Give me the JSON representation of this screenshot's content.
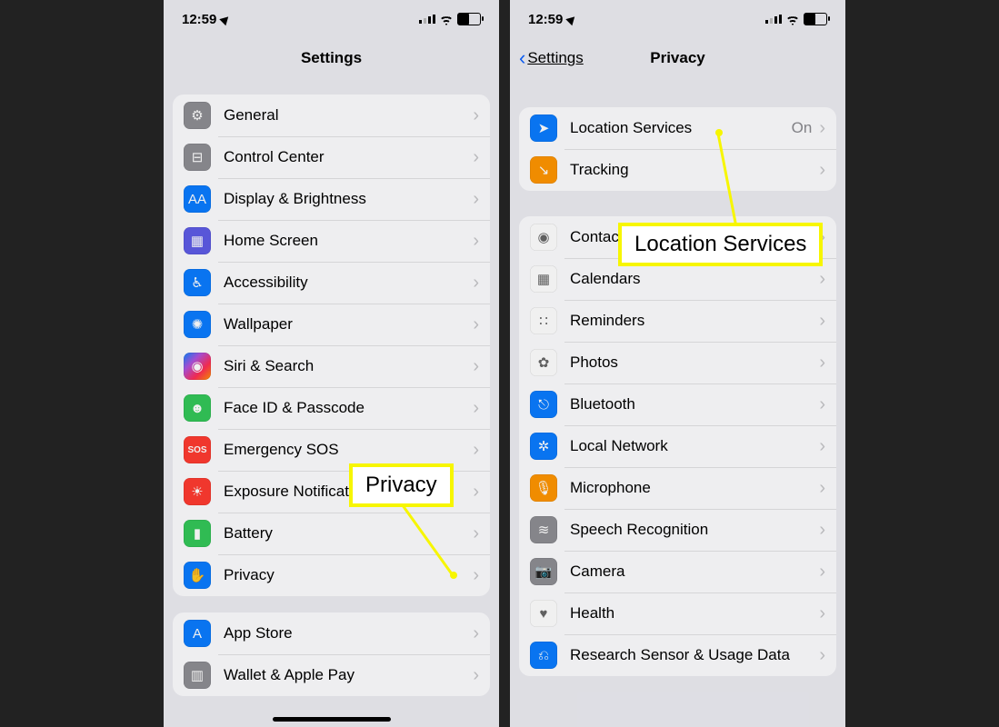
{
  "status": {
    "time": "12:59"
  },
  "left": {
    "title": "Settings",
    "group1": [
      {
        "label": "General",
        "icon": "⚙︎",
        "bg": "bg-gray"
      },
      {
        "label": "Control Center",
        "icon": "⊟",
        "bg": "bg-gray"
      },
      {
        "label": "Display & Brightness",
        "icon": "AA",
        "bg": "bg-blue"
      },
      {
        "label": "Home Screen",
        "icon": "▦",
        "bg": "bg-purple"
      },
      {
        "label": "Accessibility",
        "icon": "♿︎",
        "bg": "bg-blue"
      },
      {
        "label": "Wallpaper",
        "icon": "✺",
        "bg": "bg-blue"
      },
      {
        "label": "Siri & Search",
        "icon": "◉",
        "bg": "bg-siri"
      },
      {
        "label": "Face ID & Passcode",
        "icon": "☻",
        "bg": "bg-green"
      },
      {
        "label": "Emergency SOS",
        "icon": "SOS",
        "bg": "bg-red"
      },
      {
        "label": "Exposure Notifications",
        "icon": "☀︎",
        "bg": "bg-cor"
      },
      {
        "label": "Battery",
        "icon": "▮",
        "bg": "bg-green"
      },
      {
        "label": "Privacy",
        "icon": "✋",
        "bg": "bg-blue"
      }
    ],
    "group2": [
      {
        "label": "App Store",
        "icon": "A",
        "bg": "bg-blue"
      },
      {
        "label": "Wallet & Apple Pay",
        "icon": "▥",
        "bg": "bg-gray"
      }
    ]
  },
  "right": {
    "back": "Settings",
    "title": "Privacy",
    "group1": [
      {
        "label": "Location Services",
        "icon": "➤",
        "bg": "bg-blue",
        "detail": "On"
      },
      {
        "label": "Tracking",
        "icon": "↘︎",
        "bg": "bg-orange"
      }
    ],
    "group2": [
      {
        "label": "Contacts",
        "icon": "◉",
        "bg": "bg-white"
      },
      {
        "label": "Calendars",
        "icon": "▦",
        "bg": "bg-white"
      },
      {
        "label": "Reminders",
        "icon": "∷",
        "bg": "bg-white"
      },
      {
        "label": "Photos",
        "icon": "✿",
        "bg": "bg-white"
      },
      {
        "label": "Bluetooth",
        "icon": "⎋",
        "bg": "bg-blue"
      },
      {
        "label": "Local Network",
        "icon": "✲",
        "bg": "bg-blue"
      },
      {
        "label": "Microphone",
        "icon": "🎙",
        "bg": "bg-orange"
      },
      {
        "label": "Speech Recognition",
        "icon": "≋",
        "bg": "bg-gray"
      },
      {
        "label": "Camera",
        "icon": "📷",
        "bg": "bg-gray"
      },
      {
        "label": "Health",
        "icon": "♥︎",
        "bg": "bg-white"
      },
      {
        "label": "Research Sensor & Usage Data",
        "icon": "⎌",
        "bg": "bg-blue"
      }
    ]
  },
  "callouts": {
    "privacy": "Privacy",
    "location": "Location Services"
  }
}
